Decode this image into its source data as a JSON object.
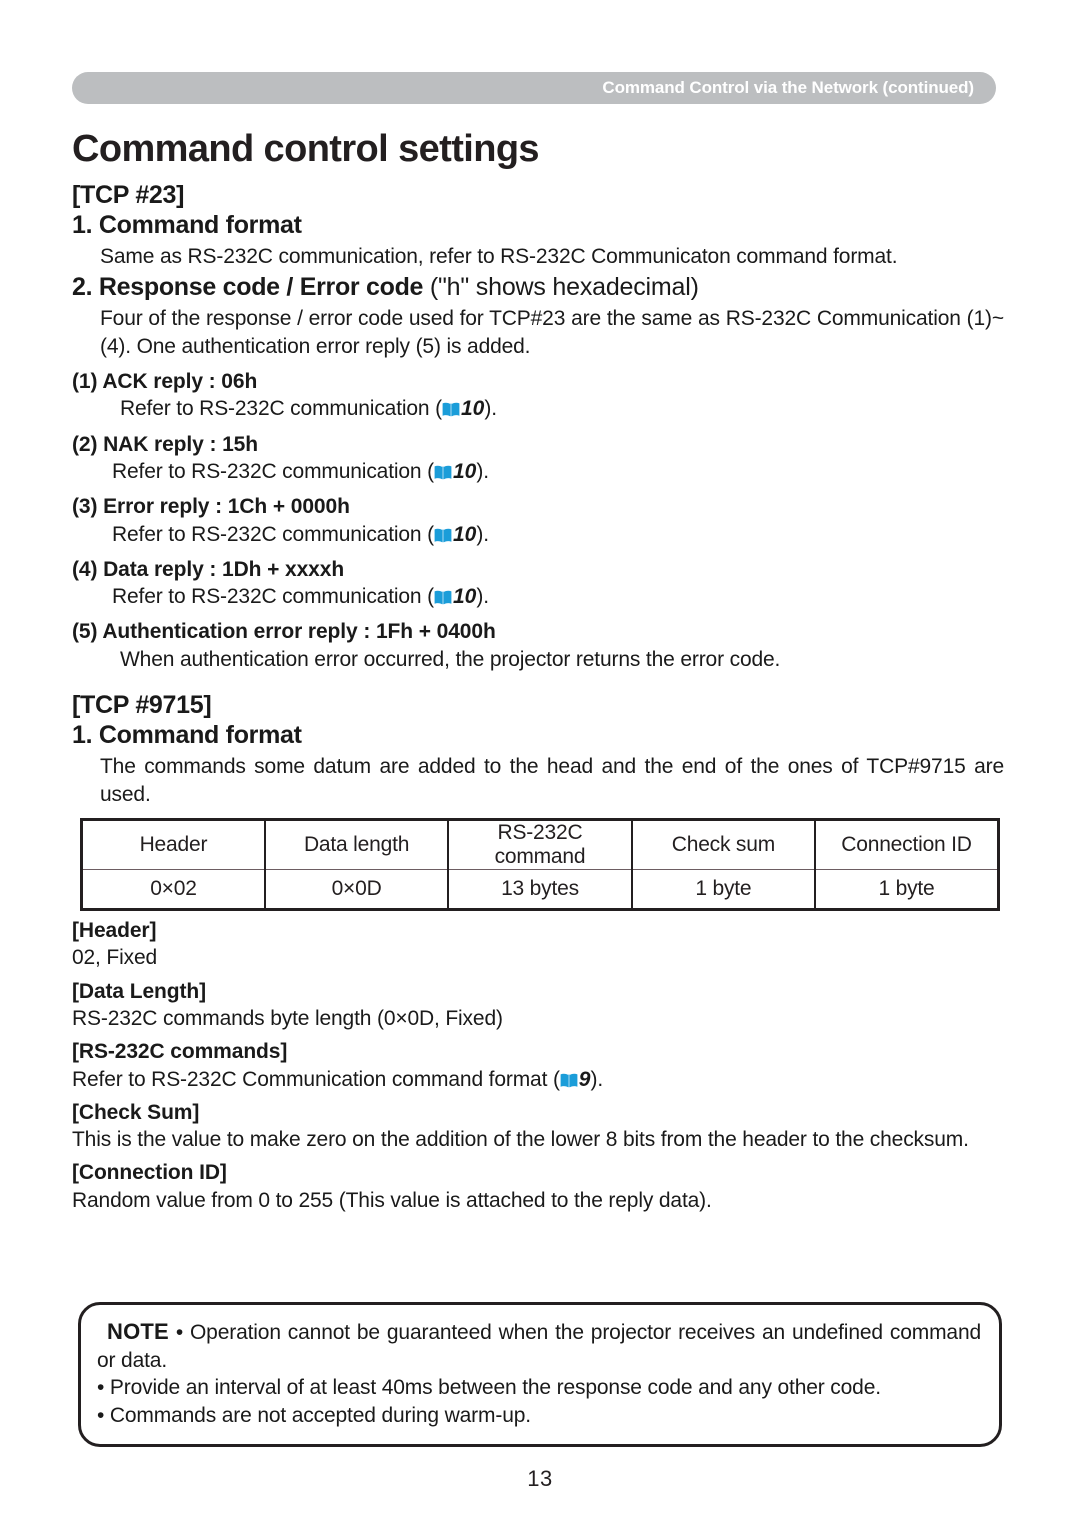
{
  "header": {
    "banner_text": "Command Control via the Network (continued)",
    "banner_color": "#bcbec0"
  },
  "title": "Command control settings",
  "book_icon_color": "#1b9dd9",
  "tcp23": {
    "label": "[TCP #23]",
    "section1": {
      "heading": "1. Command format",
      "body": "Same as RS-232C communication, refer to RS-232C Communicaton command format."
    },
    "section2": {
      "heading_bold": "2. Response code / Error code",
      "heading_normal": " (\"h\" shows hexadecimal)",
      "body": "Four of the response / error code used for TCP#23 are the same as RS-232C Communication (1)~(4). One authentication error reply (5) is added.",
      "items": [
        {
          "heading": "(1) ACK reply : 06h",
          "body_prefix": "Refer to RS-232C communication (",
          "page_ref": "10",
          "body_suffix": ")."
        },
        {
          "heading": "(2) NAK reply : 15h",
          "body_prefix": "Refer to RS-232C communication (",
          "page_ref": "10",
          "body_suffix": ")."
        },
        {
          "heading": "(3) Error reply : 1Ch + 0000h",
          "body_prefix": "Refer to RS-232C communication (",
          "page_ref": "10",
          "body_suffix": ")."
        },
        {
          "heading": "(4) Data reply : 1Dh + xxxxh",
          "body_prefix": "Refer to RS-232C communication (",
          "page_ref": "10",
          "body_suffix": ")."
        },
        {
          "heading": "(5) Authentication error reply : 1Fh + 0400h",
          "body_prefix": "When authentication error occurred, the projector returns the error code.",
          "page_ref": "",
          "body_suffix": ""
        }
      ]
    }
  },
  "tcp9715": {
    "label": "[TCP #9715]",
    "section1": {
      "heading": "1. Command format",
      "body": "The commands some datum are added to the head and the end of the ones of TCP#9715 are used."
    },
    "table": {
      "headers": [
        "Header",
        "Data length",
        "RS-232C command",
        "Check sum",
        "Connection ID"
      ],
      "values": [
        "0×02",
        "0×0D",
        "13 bytes",
        "1 byte",
        "1 byte"
      ]
    },
    "definitions": [
      {
        "term": "[Header]",
        "text": "02, Fixed",
        "page_ref": "",
        "text_suffix": ""
      },
      {
        "term": "[Data Length]",
        "text": "RS-232C commands byte length (0×0D, Fixed)",
        "page_ref": "",
        "text_suffix": ""
      },
      {
        "term": "[RS-232C commands]",
        "text": "Refer to RS-232C Communication command format (",
        "page_ref": "9",
        "text_suffix": ")."
      },
      {
        "term": "[Check Sum]",
        "text": "This is the value to make zero on the addition of the lower 8 bits from the header to the checksum.",
        "page_ref": "",
        "text_suffix": ""
      },
      {
        "term": "[Connection ID]",
        "text": "Random value from 0 to 255 (This value is attached to the reply data).",
        "page_ref": "",
        "text_suffix": ""
      }
    ]
  },
  "note": {
    "label": "NOTE",
    "first_text": "• Operation cannot be guaranteed when the projector receives an undefined command or data.",
    "bullets": [
      "• Provide an interval of at least 40ms between the response code and any other code.",
      "• Commands are not accepted during warm-up."
    ]
  },
  "page_number": "13"
}
